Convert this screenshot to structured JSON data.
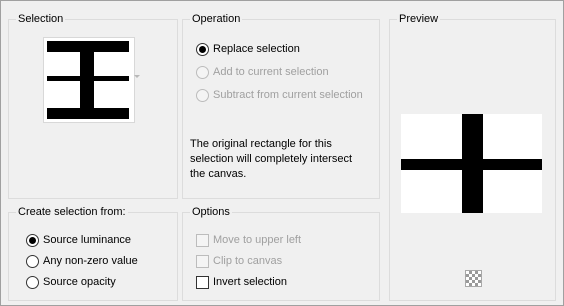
{
  "selection": {
    "title": "Selection"
  },
  "operation": {
    "title": "Operation",
    "replace_label": "Replace selection",
    "add_label": "Add to current selection",
    "subtract_label": "Subtract from current selection",
    "description": "The original rectangle for this selection will completely intersect the canvas.",
    "selected": "replace"
  },
  "preview": {
    "title": "Preview",
    "checker_icon": "transparency-checker-icon"
  },
  "create_from": {
    "title": "Create selection from:",
    "luminance_label": "Source luminance",
    "nonzero_label": "Any non-zero value",
    "opacity_label": "Source opacity",
    "selected": "luminance"
  },
  "options": {
    "title": "Options",
    "move_label": "Move to upper left",
    "clip_label": "Clip to canvas",
    "invert_label": "Invert selection",
    "move_checked": false,
    "clip_checked": false,
    "invert_checked": false
  },
  "colors": {
    "disabled_text": "#a0a0a0",
    "shape": "#000000"
  }
}
